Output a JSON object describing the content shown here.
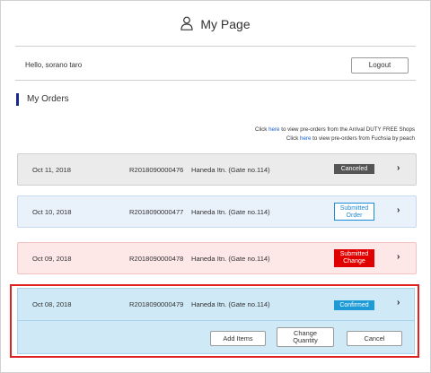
{
  "header": {
    "title": "My Page",
    "icon": "user-icon"
  },
  "account": {
    "greeting": "Hello, sorano taro",
    "logout_label": "Logout"
  },
  "section": {
    "title": "My Orders"
  },
  "info_lines": [
    {
      "prefix": "Click ",
      "link": "here",
      "suffix": " to view pre-orders from the Arrival DUTY FREE Shops"
    },
    {
      "prefix": "Click ",
      "link": "here",
      "suffix": " to view pre-orders from Fuchsia by peach"
    }
  ],
  "orders": [
    {
      "date": "Oct 11, 2018",
      "number": "R2018090000476",
      "location": "Haneda Itn. (Gate no.114)",
      "status": "Canceled"
    },
    {
      "date": "Oct 10, 2018",
      "number": "R2018090000477",
      "location": "Haneda Itn. (Gate no.114)",
      "status_line1": "Submitted",
      "status_line2": "Order"
    },
    {
      "date": "Oct 09, 2018",
      "number": "R2018090000478",
      "location": "Haneda Itn. (Gate no.114)",
      "status_line1": "Submitted",
      "status_line2": "Change"
    },
    {
      "date": "Oct 08, 2018",
      "number": "R2018090000479",
      "location": "Haneda Itn. (Gate no.114)",
      "status": "Confirmed"
    }
  ],
  "actions": {
    "add_items": "Add Items",
    "change_quantity_line1": "Change",
    "change_quantity_line2": "Quantity",
    "cancel": "Cancel"
  },
  "colors": {
    "accent": "#1a2a8c",
    "canceled": "#555555",
    "submitted_order": "#1e8ad6",
    "submitted_change": "#e00000",
    "confirmed": "#1e9bd7",
    "highlight_outline": "#e02020"
  }
}
